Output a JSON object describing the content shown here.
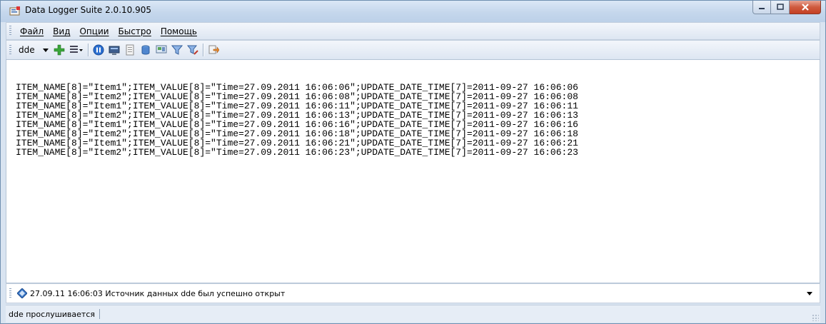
{
  "window": {
    "title": "Data Logger Suite 2.0.10.905"
  },
  "menu": {
    "items": [
      "Файл",
      "Вид",
      "Опции",
      "Быстро",
      "Помощь"
    ]
  },
  "toolbar": {
    "source_combo": "dde",
    "icons": [
      "add-icon",
      "list-dropdown-icon",
      "pause-icon",
      "monitor-icon",
      "document-icon",
      "database-icon",
      "screen-icon",
      "filter-icon",
      "filter-edit-icon",
      "export-icon"
    ]
  },
  "log": {
    "lines": [
      "ITEM_NAME[8]=\"Item1\";ITEM_VALUE[8]=\"Time=27.09.2011 16:06:06\";UPDATE_DATE_TIME[7]=2011-09-27 16:06:06",
      "ITEM_NAME[8]=\"Item2\";ITEM_VALUE[8]=\"Time=27.09.2011 16:06:08\";UPDATE_DATE_TIME[7]=2011-09-27 16:06:08",
      "ITEM_NAME[8]=\"Item1\";ITEM_VALUE[8]=\"Time=27.09.2011 16:06:11\";UPDATE_DATE_TIME[7]=2011-09-27 16:06:11",
      "ITEM_NAME[8]=\"Item2\";ITEM_VALUE[8]=\"Time=27.09.2011 16:06:13\";UPDATE_DATE_TIME[7]=2011-09-27 16:06:13",
      "ITEM_NAME[8]=\"Item1\";ITEM_VALUE[8]=\"Time=27.09.2011 16:06:16\";UPDATE_DATE_TIME[7]=2011-09-27 16:06:16",
      "ITEM_NAME[8]=\"Item2\";ITEM_VALUE[8]=\"Time=27.09.2011 16:06:18\";UPDATE_DATE_TIME[7]=2011-09-27 16:06:18",
      "ITEM_NAME[8]=\"Item1\";ITEM_VALUE[8]=\"Time=27.09.2011 16:06:21\";UPDATE_DATE_TIME[7]=2011-09-27 16:06:21",
      "ITEM_NAME[8]=\"Item2\";ITEM_VALUE[8]=\"Time=27.09.2011 16:06:23\";UPDATE_DATE_TIME[7]=2011-09-27 16:06:23"
    ]
  },
  "message_bar": {
    "text": "27.09.11 16:06:03 Источник данных dde был успешно открыт"
  },
  "status_bar": {
    "text": "dde прослушивается"
  },
  "colors": {
    "titlebar": "#c5d7ec",
    "close_button": "#c43f24",
    "frame": "#d9e4f1"
  }
}
